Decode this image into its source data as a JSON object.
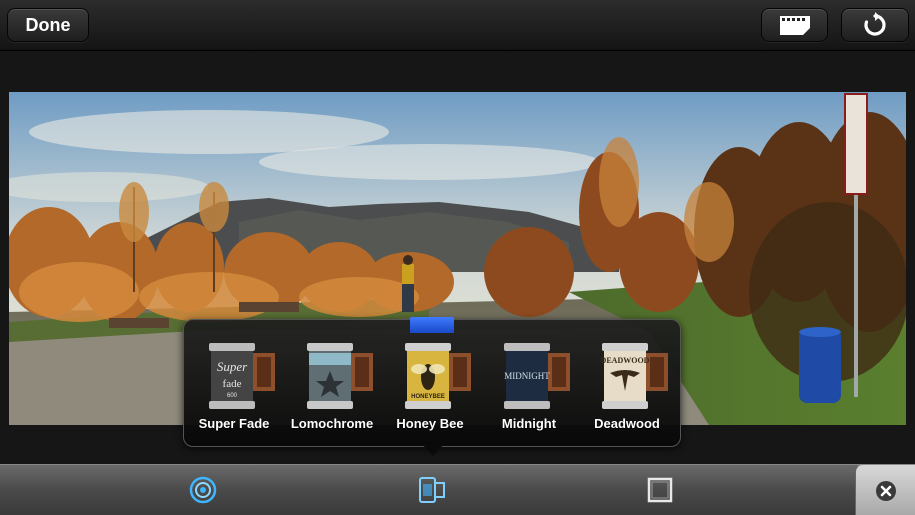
{
  "topbar": {
    "done_label": "Done",
    "film_icon": "film-strip-icon",
    "rotate_icon": "rotate-icon"
  },
  "photo": {
    "subject": "panoramic-autumn-landscape"
  },
  "filters": {
    "selected": "Honey Bee",
    "items": [
      {
        "label": "Super Fade",
        "can_text": "Super fade 600",
        "color": "#3d3d3d"
      },
      {
        "label": "Lomochrome",
        "can_text": "",
        "color": "#6f7f85"
      },
      {
        "label": "Honey Bee",
        "can_text": "HONEYBEE",
        "color": "#d4b23a"
      },
      {
        "label": "Midnight",
        "can_text": "MIDNIGHT",
        "color": "#22344a"
      },
      {
        "label": "Deadwood",
        "can_text": "DEADWOOD",
        "color": "#e8dfcb"
      }
    ]
  },
  "toolbar": {
    "effects_icon": "lens-icon",
    "film_icon": "film-can-icon",
    "crop_icon": "crop-frame-icon",
    "close_icon": "close-icon",
    "accent": "#3fb6ff"
  }
}
